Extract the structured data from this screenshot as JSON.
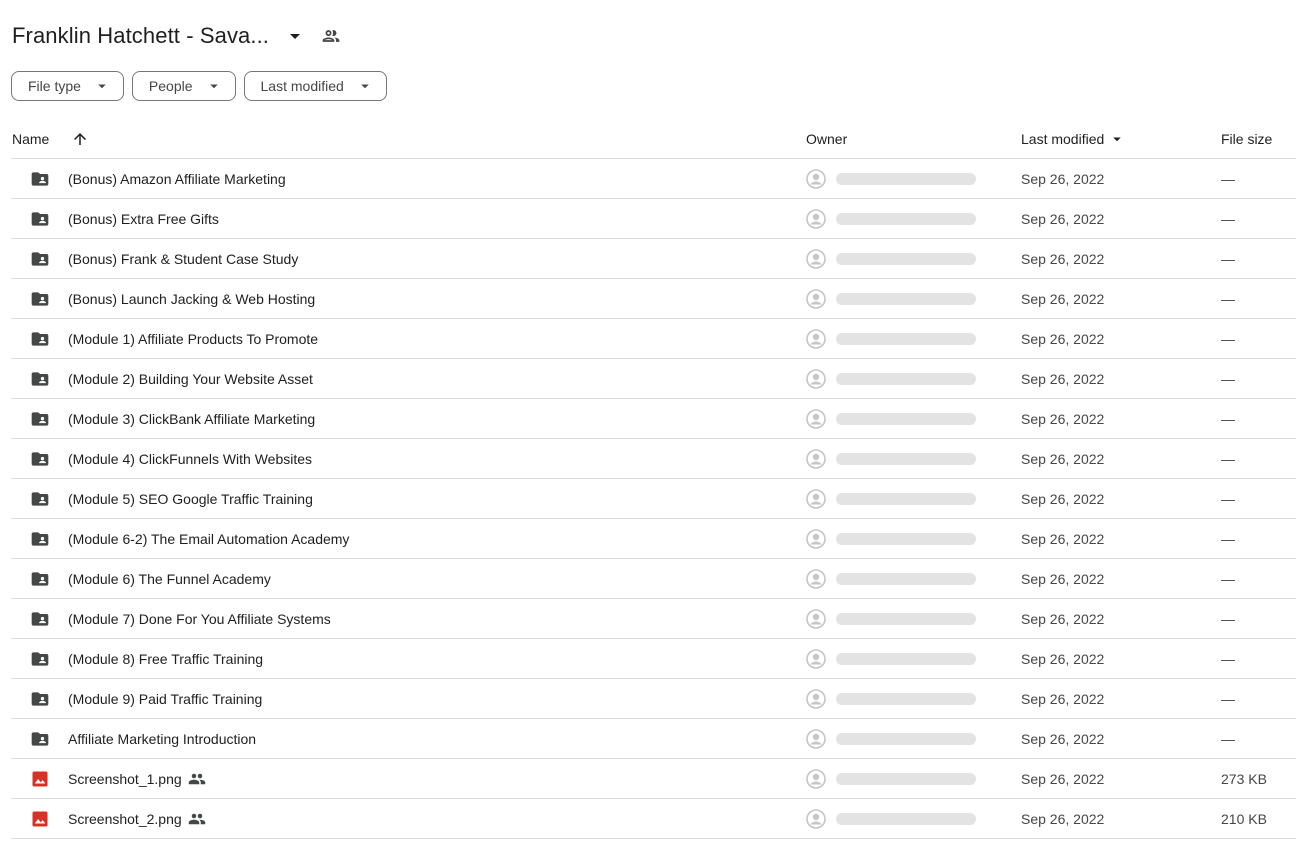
{
  "header": {
    "folder_title": "Franklin Hatchett - Sava...",
    "caret_icon": "arrow-drop-down-icon",
    "shared_icon": "people-icon"
  },
  "filters": [
    {
      "label": "File type"
    },
    {
      "label": "People"
    },
    {
      "label": "Last modified"
    }
  ],
  "columns": {
    "name": "Name",
    "owner": "Owner",
    "last_modified": "Last modified",
    "file_size": "File size",
    "sort_icon": "arrow-upward-icon"
  },
  "colors": {
    "folder": "#444746",
    "image_file": "#d93025",
    "owner_placeholder": "#e3e3e3",
    "border": "#dadce0"
  },
  "files": [
    {
      "name": "(Bonus) Amazon Affiliate Marketing",
      "type": "shared-folder",
      "modified": "Sep 26, 2022",
      "size": "—",
      "shared": false
    },
    {
      "name": "(Bonus) Extra Free Gifts",
      "type": "shared-folder",
      "modified": "Sep 26, 2022",
      "size": "—",
      "shared": false
    },
    {
      "name": "(Bonus) Frank & Student Case Study",
      "type": "shared-folder",
      "modified": "Sep 26, 2022",
      "size": "—",
      "shared": false
    },
    {
      "name": "(Bonus) Launch Jacking & Web Hosting",
      "type": "shared-folder",
      "modified": "Sep 26, 2022",
      "size": "—",
      "shared": false
    },
    {
      "name": "(Module 1) Affiliate Products To Promote",
      "type": "shared-folder",
      "modified": "Sep 26, 2022",
      "size": "—",
      "shared": false
    },
    {
      "name": "(Module 2) Building Your Website Asset",
      "type": "shared-folder",
      "modified": "Sep 26, 2022",
      "size": "—",
      "shared": false
    },
    {
      "name": "(Module 3) ClickBank Affiliate Marketing",
      "type": "shared-folder",
      "modified": "Sep 26, 2022",
      "size": "—",
      "shared": false
    },
    {
      "name": "(Module 4) ClickFunnels With Websites",
      "type": "shared-folder",
      "modified": "Sep 26, 2022",
      "size": "—",
      "shared": false
    },
    {
      "name": "(Module 5) SEO Google Traffic Training",
      "type": "shared-folder",
      "modified": "Sep 26, 2022",
      "size": "—",
      "shared": false
    },
    {
      "name": "(Module 6-2) The Email Automation Academy",
      "type": "shared-folder",
      "modified": "Sep 26, 2022",
      "size": "—",
      "shared": false
    },
    {
      "name": "(Module 6) The Funnel Academy",
      "type": "shared-folder",
      "modified": "Sep 26, 2022",
      "size": "—",
      "shared": false
    },
    {
      "name": "(Module 7) Done For You Affiliate Systems",
      "type": "shared-folder",
      "modified": "Sep 26, 2022",
      "size": "—",
      "shared": false
    },
    {
      "name": "(Module 8) Free Traffic Training",
      "type": "shared-folder",
      "modified": "Sep 26, 2022",
      "size": "—",
      "shared": false
    },
    {
      "name": "(Module 9) Paid Traffic Training",
      "type": "shared-folder",
      "modified": "Sep 26, 2022",
      "size": "—",
      "shared": false
    },
    {
      "name": "Affiliate Marketing Introduction",
      "type": "shared-folder",
      "modified": "Sep 26, 2022",
      "size": "—",
      "shared": false
    },
    {
      "name": "Screenshot_1.png",
      "type": "image",
      "modified": "Sep 26, 2022",
      "size": "273 KB",
      "shared": true
    },
    {
      "name": "Screenshot_2.png",
      "type": "image",
      "modified": "Sep 26, 2022",
      "size": "210 KB",
      "shared": true
    }
  ]
}
